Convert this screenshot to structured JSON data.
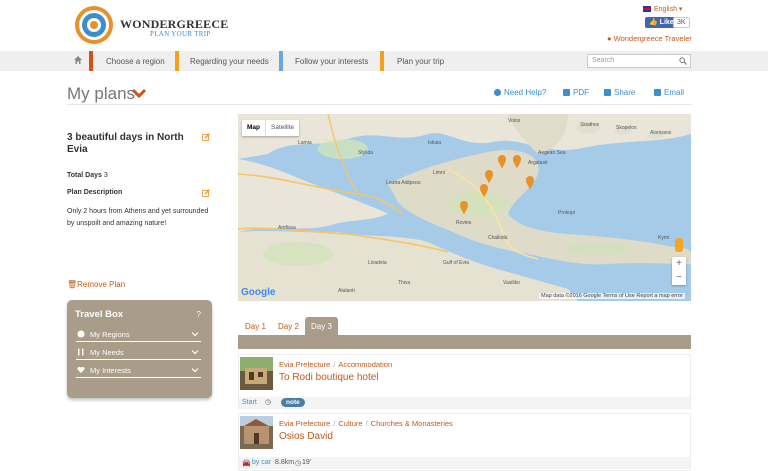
{
  "header": {
    "logo_name": "WONDERGREECE",
    "logo_tagline": "PLAN YOUR TRIP",
    "language": "English",
    "fb_like": "Like",
    "fb_count": "3K",
    "traveler": "Wondergreece Traveler"
  },
  "nav": {
    "items": [
      "Choose a region",
      "Regarding your needs",
      "Follow your interests",
      "Plan your trip"
    ],
    "bar_colors": [
      "#d3501c",
      "#f0a21e",
      "#6aa7d8",
      "#f0a21e"
    ],
    "search_placeholder": "Search"
  },
  "page": {
    "title": "My plans",
    "actions": [
      "Need Help?",
      "PDF",
      "Share",
      "Email"
    ]
  },
  "plan": {
    "title": "3 beautiful days in North Evia",
    "total_days_label": "Total Days",
    "total_days_value": "3",
    "description_label": "Plan Description",
    "description": "Only 2 hours from Athens and yet surrounded by unspoilt and amazing nature!",
    "remove_label": "Remove Plan"
  },
  "travel_box": {
    "title": "Travel Box",
    "help": "?",
    "items": [
      "My Regions",
      "My Needs",
      "My Interests"
    ]
  },
  "map": {
    "type_buttons": [
      "Map",
      "Satellite"
    ],
    "footer": "Map data ©2016 Google   Terms of Use   Report a map error",
    "google": "Google",
    "zoom_in": "+",
    "zoom_out": "−",
    "labels": [
      "Volos",
      "Argalasti",
      "Skiathos",
      "Skopelos",
      "Alonissos",
      "Stylida",
      "Lamia",
      "Amfissa",
      "Atalanti",
      "Livadeia",
      "Thiva",
      "Chalkida",
      "Istiaia",
      "Limni",
      "Prokopi",
      "Kymi",
      "Loutra Aidipsou",
      "Rovies",
      "Gulf of Evia",
      "Aegean Sea",
      "Vasiliko"
    ]
  },
  "days": {
    "tabs": [
      "Day 1",
      "Day 2",
      "Day 3"
    ],
    "active": 2
  },
  "entries": [
    {
      "crumbs": [
        "Evia Prefecture",
        "Accommodation"
      ],
      "title": "To Rodi boutique hotel",
      "foot_start": "Start",
      "foot_badge": "note"
    },
    {
      "crumbs": [
        "Evia Prefecture",
        "Culture",
        "Churches & Monasteries"
      ],
      "title": "Osios David",
      "foot_mode": "by car",
      "foot_dist": "8.8km",
      "foot_time": "19'"
    }
  ]
}
